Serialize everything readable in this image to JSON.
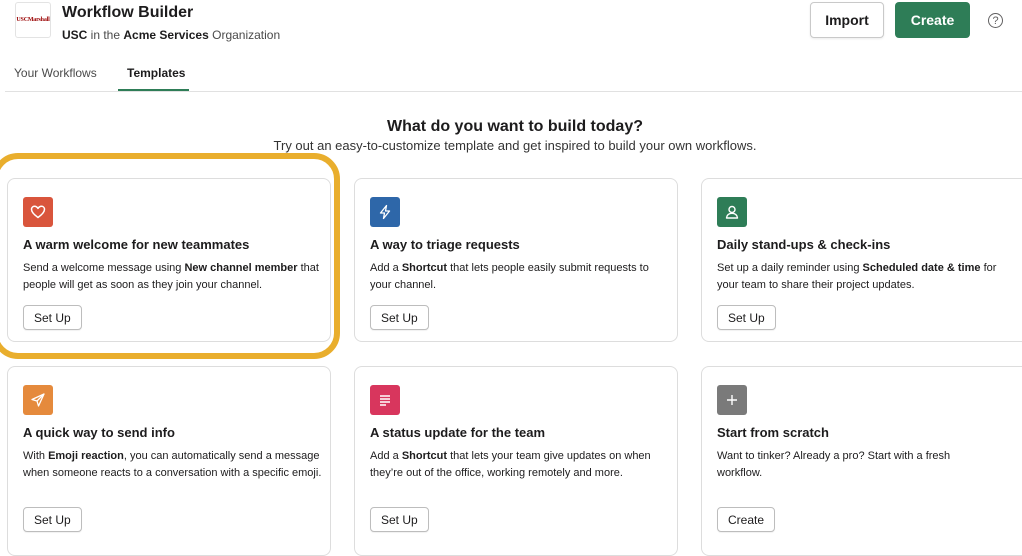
{
  "header": {
    "logo_text": "USCMarshall",
    "title": "Workflow Builder",
    "subtitle_prefix": "USC",
    "subtitle_mid": " in the ",
    "subtitle_org": "Acme Services",
    "subtitle_suffix": " Organization",
    "import_label": "Import",
    "create_label": "Create",
    "help_glyph": "?"
  },
  "tabs": [
    {
      "label": "Your Workflows",
      "active": false
    },
    {
      "label": "Templates",
      "active": true
    }
  ],
  "hero": {
    "title": "What do you want to build today?",
    "subtitle": "Try out an easy-to-customize template and get inspired to build your own workflows."
  },
  "cards": [
    {
      "title": "A warm welcome for new teammates",
      "desc_pre": "Send a welcome message using ",
      "desc_bold": "New channel member",
      "desc_post": " that people will get as soon as they join your channel.",
      "button": "Set Up",
      "icon": "heart-icon",
      "icon_color": "#d9553c",
      "highlighted": true
    },
    {
      "title": "A way to triage requests",
      "desc_pre": "Add a ",
      "desc_bold": "Shortcut",
      "desc_post": " that lets people easily submit requests to your channel.",
      "button": "Set Up",
      "icon": "lightning-icon",
      "icon_color": "#2e67a9"
    },
    {
      "title": "Daily stand-ups & check-ins",
      "desc_pre": "Set up a daily reminder using ",
      "desc_bold": "Scheduled date & time",
      "desc_post": " for your team to share their project updates.",
      "button": "Set Up",
      "icon": "person-icon",
      "icon_color": "#2e7d57"
    },
    {
      "title": "A quick way to send info",
      "desc_pre": "With ",
      "desc_bold": "Emoji reaction",
      "desc_post": ", you can automatically send a message when someone reacts to a conversation with a specific emoji.",
      "button": "Set Up",
      "icon": "paper-plane-icon",
      "icon_color": "#e58a3c"
    },
    {
      "title": "A status update for the team",
      "desc_pre": "Add a ",
      "desc_bold": "Shortcut",
      "desc_post": " that lets your team give updates on when they’re out of the office, working remotely and more.",
      "button": "Set Up",
      "icon": "list-icon",
      "icon_color": "#d8365d"
    },
    {
      "title": "Start from scratch",
      "desc_pre": "Want to tinker? Already a pro? Start with a fresh workflow.",
      "desc_bold": "",
      "desc_post": "",
      "button": "Create",
      "icon": "plus-icon",
      "icon_color": "#7a7a7a"
    }
  ]
}
